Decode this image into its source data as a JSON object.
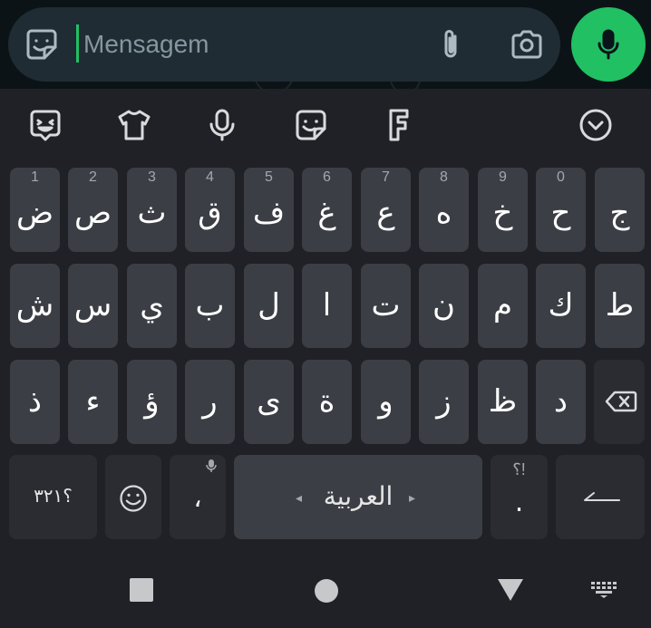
{
  "composer": {
    "placeholder": "Mensagem"
  },
  "icons": {
    "composer": [
      "sticker-icon",
      "attach-icon",
      "camera-icon",
      "mic-icon"
    ],
    "toolbar": [
      "emoji-sticker-icon",
      "theme-shirt-icon",
      "voice-input-icon",
      "stickers-icon",
      "font-icon",
      "collapse-icon"
    ],
    "nav": [
      "recents-square-icon",
      "home-circle-icon",
      "back-triangle-icon",
      "keyboard-icon"
    ]
  },
  "colors": {
    "accent": "#21c063",
    "keyboard_bg": "#1f2126",
    "key_bg": "#3b3e45",
    "key_dark_bg": "#2a2c32",
    "composer_bg": "#1f2c33",
    "chat_bg": "#0c1317"
  },
  "keyboard": {
    "row1": [
      {
        "hint": "1",
        "label": "ض"
      },
      {
        "hint": "2",
        "label": "ص"
      },
      {
        "hint": "3",
        "label": "ث"
      },
      {
        "hint": "4",
        "label": "ق"
      },
      {
        "hint": "5",
        "label": "ف"
      },
      {
        "hint": "6",
        "label": "غ"
      },
      {
        "hint": "7",
        "label": "ع"
      },
      {
        "hint": "8",
        "label": "ه"
      },
      {
        "hint": "9",
        "label": "خ"
      },
      {
        "hint": "0",
        "label": "ح"
      },
      {
        "hint": "",
        "label": "ج"
      }
    ],
    "row2": [
      "ش",
      "س",
      "ي",
      "ب",
      "ل",
      "ا",
      "ت",
      "ن",
      "م",
      "ك",
      "ط"
    ],
    "row3": [
      "ذ",
      "ء",
      "ؤ",
      "ر",
      "ى",
      "ة",
      "و",
      "ز",
      "ظ",
      "د"
    ],
    "bottom": {
      "numbers_label": "؟٣٢١",
      "comma_label": "،",
      "space_label": "العربية",
      "space_left_arrow": "◂",
      "space_right_arrow": "▸",
      "period_hint": "؟!",
      "period_label": "."
    }
  }
}
